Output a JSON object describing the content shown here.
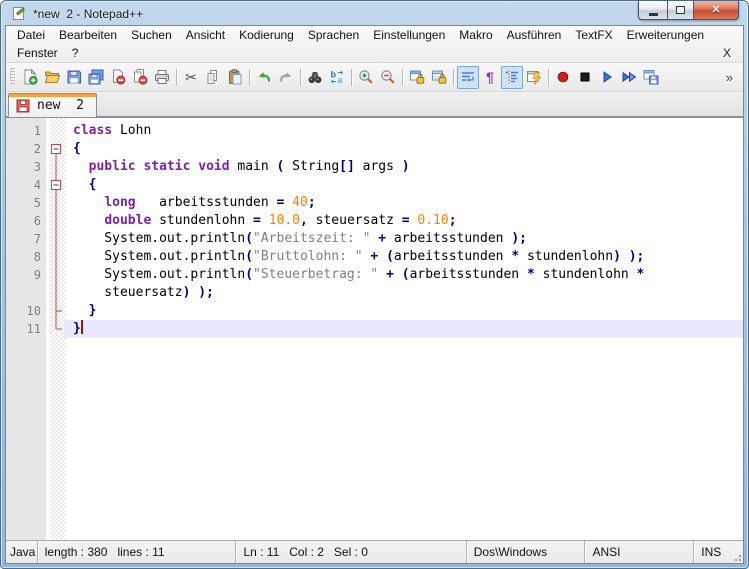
{
  "window": {
    "title": "*new  2 - Notepad++"
  },
  "menubar": {
    "row1": [
      "Datei",
      "Bearbeiten",
      "Suchen",
      "Ansicht",
      "Kodierung",
      "Sprachen",
      "Einstellungen",
      "Makro",
      "Ausführen",
      "TextFX",
      "Erweiterungen"
    ],
    "row2": [
      "Fenster",
      "?"
    ],
    "close_label": "X"
  },
  "toolbar": {
    "overflow_label": "»",
    "groups": [
      [
        "new-file",
        "open-folder",
        "save-file",
        "save-all",
        "close-file",
        "close-all",
        "print"
      ],
      [
        "cut",
        "copy",
        "paste"
      ],
      [
        "undo",
        "redo"
      ],
      [
        "find",
        "replace"
      ],
      [
        "zoom-in",
        "zoom-out"
      ],
      [
        "sync-vertical-scroll",
        "sync-horizontal-scroll"
      ],
      [
        {
          "name": "word-wrap",
          "pressed": true
        },
        "show-all-characters",
        {
          "name": "indent-guide",
          "pressed": true
        },
        "function-completion"
      ],
      [
        "macro-record",
        "macro-stop",
        "macro-play",
        "macro-run-multiple",
        "macro-save"
      ]
    ]
  },
  "tabbar": {
    "tabs": [
      {
        "label": "new  2",
        "modified": true,
        "active": true
      }
    ]
  },
  "editor": {
    "colors": {
      "keyword": "#7D1FA8",
      "number": "#FF8000",
      "string": "#808080",
      "operator": "#000080",
      "plain": "#000000",
      "line_number": "#808080",
      "current_line_bg": "#E8E8FF",
      "fold": "#C04848"
    },
    "lines": [
      {
        "num": "1",
        "fold": "",
        "tokens": [
          [
            "k",
            "class"
          ],
          [
            "p",
            " Lohn"
          ]
        ]
      },
      {
        "num": "2",
        "fold": "box-start",
        "tokens": [
          [
            "o",
            "{"
          ]
        ]
      },
      {
        "num": "3",
        "fold": "v",
        "tokens": [
          [
            "p",
            "  "
          ],
          [
            "k",
            "public"
          ],
          [
            "p",
            " "
          ],
          [
            "k",
            "static"
          ],
          [
            "p",
            " "
          ],
          [
            "k",
            "void"
          ],
          [
            "p",
            " main "
          ],
          [
            "o",
            "("
          ],
          [
            "p",
            " String"
          ],
          [
            "o",
            "[]"
          ],
          [
            "p",
            " args "
          ],
          [
            "o",
            ")"
          ]
        ]
      },
      {
        "num": "4",
        "fold": "box-mid",
        "tokens": [
          [
            "p",
            "  "
          ],
          [
            "o",
            "{"
          ]
        ]
      },
      {
        "num": "5",
        "fold": "v",
        "tokens": [
          [
            "p",
            "    "
          ],
          [
            "k",
            "long"
          ],
          [
            "p",
            "   arbeitsstunden "
          ],
          [
            "o",
            "="
          ],
          [
            "p",
            " "
          ],
          [
            "n",
            "40"
          ],
          [
            "o",
            ";"
          ]
        ]
      },
      {
        "num": "6",
        "fold": "v",
        "tokens": [
          [
            "p",
            "    "
          ],
          [
            "k",
            "double"
          ],
          [
            "p",
            " stundenlohn "
          ],
          [
            "o",
            "="
          ],
          [
            "p",
            " "
          ],
          [
            "n",
            "10.0"
          ],
          [
            "o",
            ","
          ],
          [
            "p",
            " steuersatz "
          ],
          [
            "o",
            "="
          ],
          [
            "p",
            " "
          ],
          [
            "n",
            "0.10"
          ],
          [
            "o",
            ";"
          ]
        ]
      },
      {
        "num": "7",
        "fold": "v",
        "tokens": [
          [
            "p",
            "    System.out.println"
          ],
          [
            "o",
            "("
          ],
          [
            "s",
            "\"Arbeitszeit: \""
          ],
          [
            "p",
            " "
          ],
          [
            "o",
            "+"
          ],
          [
            "p",
            " arbeitsstunden "
          ],
          [
            "o",
            ");"
          ]
        ]
      },
      {
        "num": "8",
        "fold": "v",
        "tokens": [
          [
            "p",
            "    System.out.println"
          ],
          [
            "o",
            "("
          ],
          [
            "s",
            "\"Bruttolohn: \""
          ],
          [
            "p",
            " "
          ],
          [
            "o",
            "+"
          ],
          [
            "p",
            " "
          ],
          [
            "o",
            "("
          ],
          [
            "p",
            "arbeitsstunden "
          ],
          [
            "o",
            "*"
          ],
          [
            "p",
            " stundenlohn"
          ],
          [
            "o",
            ")"
          ],
          [
            "p",
            " "
          ],
          [
            "o",
            ");"
          ]
        ]
      },
      {
        "num": "9",
        "fold": "v",
        "tokens": [
          [
            "p",
            "    System.out.println"
          ],
          [
            "o",
            "("
          ],
          [
            "s",
            "\"Steuerbetrag: \""
          ],
          [
            "p",
            " "
          ],
          [
            "o",
            "+"
          ],
          [
            "p",
            " "
          ],
          [
            "o",
            "("
          ],
          [
            "p",
            "arbeitsstunden "
          ],
          [
            "o",
            "*"
          ],
          [
            "p",
            " stundenlohn "
          ],
          [
            "o",
            "*"
          ]
        ]
      },
      {
        "num": "",
        "fold": "v",
        "tokens": [
          [
            "p",
            "    steuersatz"
          ],
          [
            "o",
            ")"
          ],
          [
            "p",
            " "
          ],
          [
            "o",
            ");"
          ]
        ]
      },
      {
        "num": "10",
        "fold": "tee",
        "tokens": [
          [
            "p",
            "  "
          ],
          [
            "o",
            "}"
          ]
        ]
      },
      {
        "num": "11",
        "fold": "end",
        "tokens": [
          [
            "o",
            "}"
          ]
        ],
        "current": true,
        "caret": true
      }
    ]
  },
  "statusbar": {
    "language": "Java",
    "doc_info": "length : 380   lines : 11",
    "position": "Ln : 11   Col : 2   Sel : 0",
    "eol": "Dos\\Windows",
    "encoding": "ANSI",
    "mode": "INS"
  }
}
